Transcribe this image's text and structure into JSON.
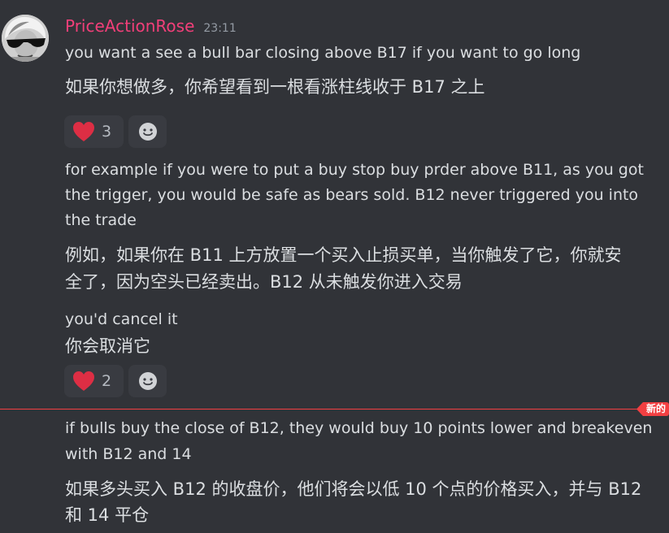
{
  "message": {
    "username": "PriceActionRose",
    "timestamp": "23:11",
    "avatar_icon": "avatar-portrait-sunglasses"
  },
  "lines": {
    "l1_en": "you want a see a bull bar closing above B17 if you want to go long",
    "l1_zh": "如果你想做多，你希望看到一根看涨柱线收于 B17 之上",
    "l2_en_a": "for example if you were to put a buy stop buy prder above B11, as you got",
    "l2_en_b": "the trigger, you would be safe as bears sold. B12 never triggered you into",
    "l2_en_c": "the trade",
    "l2_zh_a": "例如，如果你在 B11 上方放置一个买入止损买单，当你触发了它，你就安",
    "l2_zh_b": "全了，因为空头已经卖出。B12 从未触发你进入交易",
    "l3_en": "you'd cancel it",
    "l3_zh": "你会取消它",
    "l4_en_a": "if bulls buy the close of B12, they would buy 10 points lower and breakeven",
    "l4_en_b": "with B12 and 14",
    "l4_zh_a": "如果多头买入 B12 的收盘价，他们将会以低 10 个点的价格买入，并与 B12",
    "l4_zh_b": "和 14 平仓"
  },
  "reactions": {
    "r1": {
      "emoji": "red-heart",
      "count": "3"
    },
    "r2": {
      "emoji": "red-heart",
      "count": "2"
    },
    "add_icon": "add-reaction-smiley-icon"
  },
  "divider": {
    "label": "新的",
    "color": "#f23f42"
  },
  "colors": {
    "background": "#313338",
    "username": "#f23f79",
    "text": "#dbdee1",
    "muted": "#949ba4",
    "reaction_bg": "#393b41"
  }
}
